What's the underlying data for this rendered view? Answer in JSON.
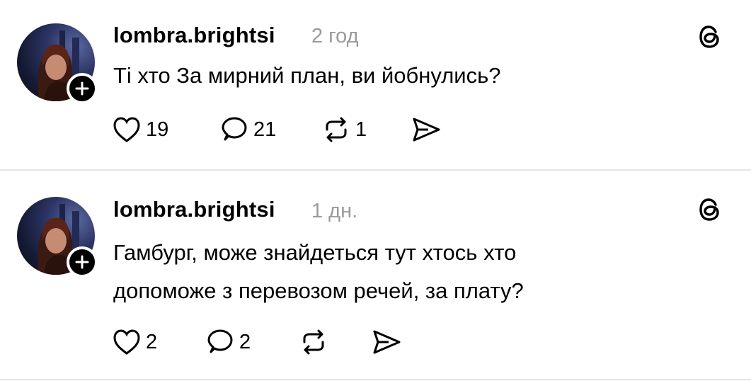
{
  "posts": [
    {
      "username": "lombra.brightsi",
      "time": "2 год",
      "text_lines": [
        "Ті хто За мирний план, ви йобнулись?"
      ],
      "likes": "19",
      "comments": "21",
      "reposts": "1"
    },
    {
      "username": "lombra.brightsi",
      "time": "1 дн.",
      "text_lines": [
        "Гамбург, може знайдеться тут хтось хто",
        "допоможе з перевозом речей, за плату?"
      ],
      "likes": "2",
      "comments": "2",
      "reposts": ""
    }
  ],
  "icons": [
    "heart-icon",
    "comment-icon",
    "repost-icon",
    "share-icon",
    "threads-icon",
    "plus-icon"
  ]
}
